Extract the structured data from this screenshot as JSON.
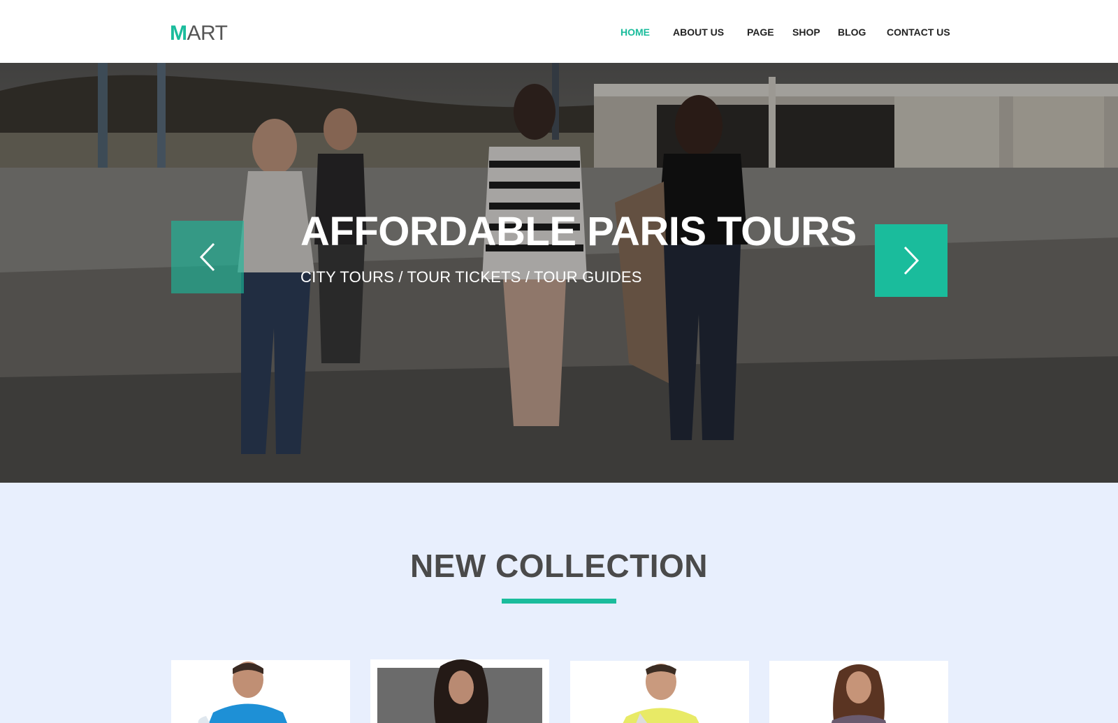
{
  "logo": {
    "accent_letter": "M",
    "rest": "ART"
  },
  "nav": {
    "items": [
      {
        "label": "HOME",
        "active": true
      },
      {
        "label": "ABOUT US",
        "active": false
      },
      {
        "label": "PAGE",
        "active": false
      },
      {
        "label": "SHOP",
        "active": false
      },
      {
        "label": "BLOG",
        "active": false
      },
      {
        "label": "CONTACT US",
        "active": false
      }
    ]
  },
  "hero": {
    "title": "AFFORDABLE PARIS TOURS",
    "subtitle": "CITY TOURS / TOUR TICKETS / TOUR GUIDES",
    "prev_icon": "chevron-left-icon",
    "next_icon": "chevron-right-icon"
  },
  "collection": {
    "title": "NEW COLLECTION",
    "products": [
      {
        "image": "man-blue-shirt-photo"
      },
      {
        "image": "woman-dark-hair-photo"
      },
      {
        "image": "man-yellow-shirt-photo"
      },
      {
        "image": "woman-patterned-top-photo"
      }
    ]
  },
  "colors": {
    "accent": "#1abc9c",
    "nav_text": "#222222",
    "section_bg": "#e8effd",
    "title_text": "#4a4a4a"
  }
}
